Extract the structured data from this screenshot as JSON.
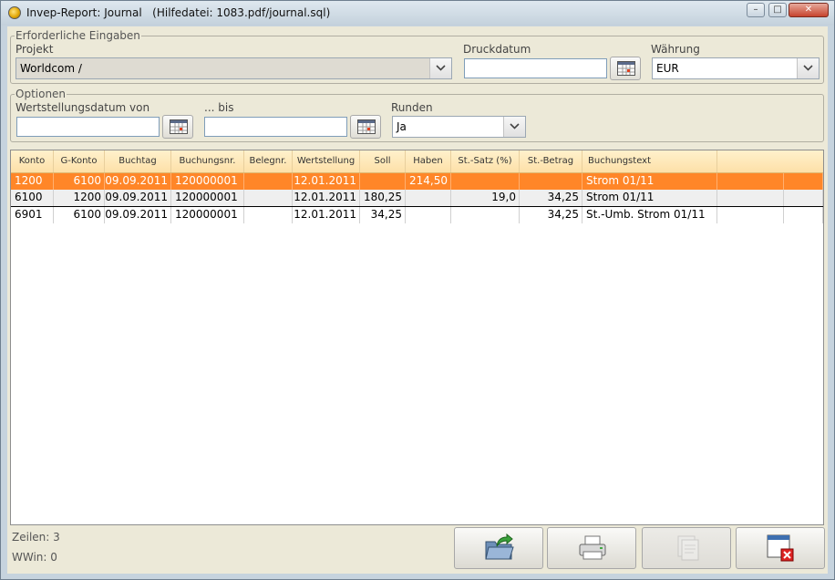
{
  "window": {
    "title": "Invep-Report: Journal",
    "help_file": "(Hilfedatei: 1083.pdf/journal.sql)",
    "minimize_glyph": "–",
    "maximize_glyph": "□",
    "close_glyph": "✕"
  },
  "required": {
    "legend": "Erforderliche Eingaben",
    "projekt_label": "Projekt",
    "projekt_value": "Worldcom /",
    "druckdatum_label": "Druckdatum",
    "druckdatum_value": "",
    "waehrung_label": "Währung",
    "waehrung_value": "EUR"
  },
  "options": {
    "legend": "Optionen",
    "von_label": "Wertstellungsdatum von",
    "von_value": "",
    "bis_label": "... bis",
    "bis_value": "",
    "runden_label": "Runden",
    "runden_value": "Ja"
  },
  "table": {
    "columns": [
      "Konto",
      "G-Konto",
      "Buchtag",
      "Buchungsnr.",
      "Belegnr.",
      "Wertstellung",
      "Soll",
      "Haben",
      "St.-Satz (%)",
      "St.-Betrag",
      "Buchungstext"
    ],
    "rows": [
      [
        "1200",
        "6100",
        "09.09.2011",
        "120000001",
        "",
        "12.01.2011",
        "",
        "214,50",
        "",
        "",
        "Strom 01/11"
      ],
      [
        "6100",
        "1200",
        "09.09.2011",
        "120000001",
        "",
        "12.01.2011",
        "180,25",
        "",
        "19,0",
        "34,25",
        "Strom 01/11"
      ],
      [
        "6901",
        "6100",
        "09.09.2011",
        "120000001",
        "",
        "12.01.2011",
        "34,25",
        "",
        "",
        "34,25",
        "St.-Umb. Strom 01/11"
      ]
    ],
    "selected_row": 0
  },
  "status": {
    "zeilen": "Zeilen: 3",
    "wwin": "WWin: 0"
  },
  "colors": {
    "selected_row": "#ff8628",
    "header_bg": "#fde0a8",
    "client_bg": "#ece9d8"
  },
  "buttons": [
    {
      "icon": "export-folder-icon",
      "enabled": true
    },
    {
      "icon": "printer-icon",
      "enabled": true
    },
    {
      "icon": "print-preview-icon",
      "enabled": false
    },
    {
      "icon": "close-window-icon",
      "enabled": true
    }
  ]
}
